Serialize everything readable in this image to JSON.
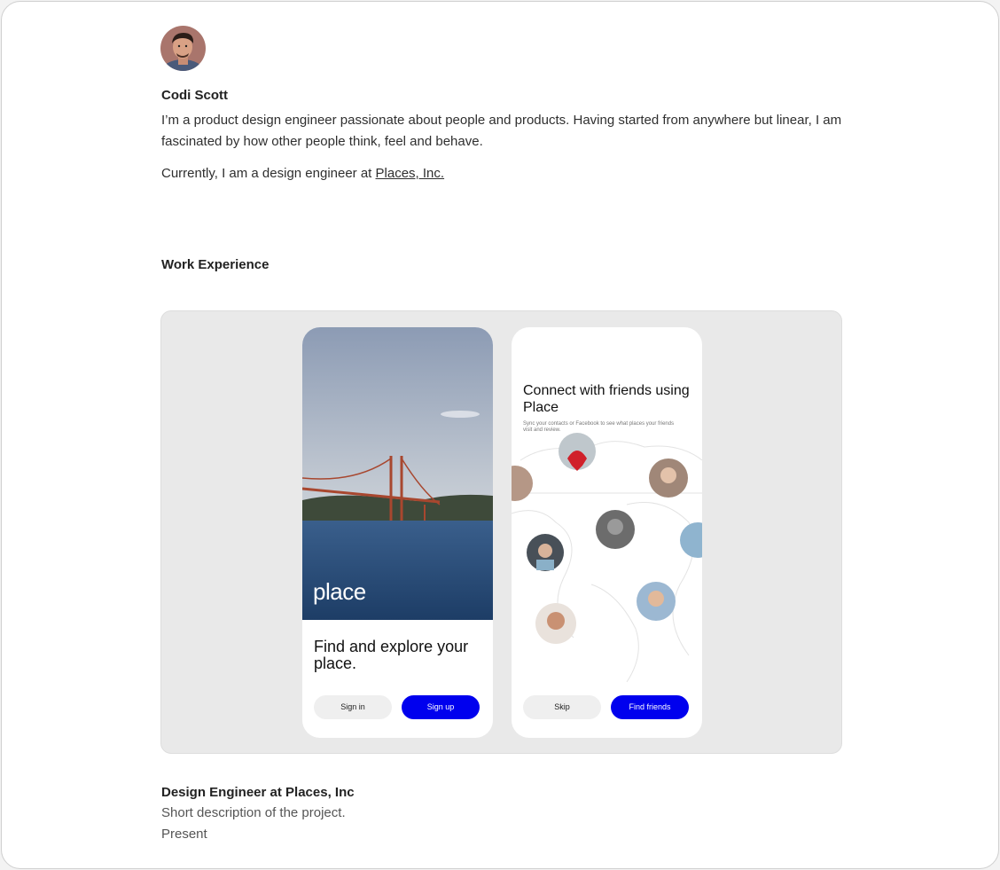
{
  "profile": {
    "name": "Codi Scott",
    "bio": "I’m a product design engineer passionate about people and products. Having started from anywhere but linear, I am fascinated by how other people think, feel and behave.",
    "current_prefix": "Currently, I am a design engineer at ",
    "company_link": "Places, Inc."
  },
  "work": {
    "section_title": "Work Experience",
    "projects": [
      {
        "title": "Design Engineer at Places, Inc",
        "description": "Short description of the project.",
        "date": "Present"
      }
    ]
  },
  "showcase": {
    "phone1": {
      "logo": "place",
      "headline": "Find and explore your place.",
      "secondary_button": "Sign in",
      "primary_button": "Sign up"
    },
    "phone2": {
      "headline": "Connect with friends using Place",
      "subtext": "Sync your contacts or Facebook to see what places your friends visit and review.",
      "secondary_button": "Skip",
      "primary_button": "Find friends"
    },
    "accent_color": "#0000ee"
  }
}
